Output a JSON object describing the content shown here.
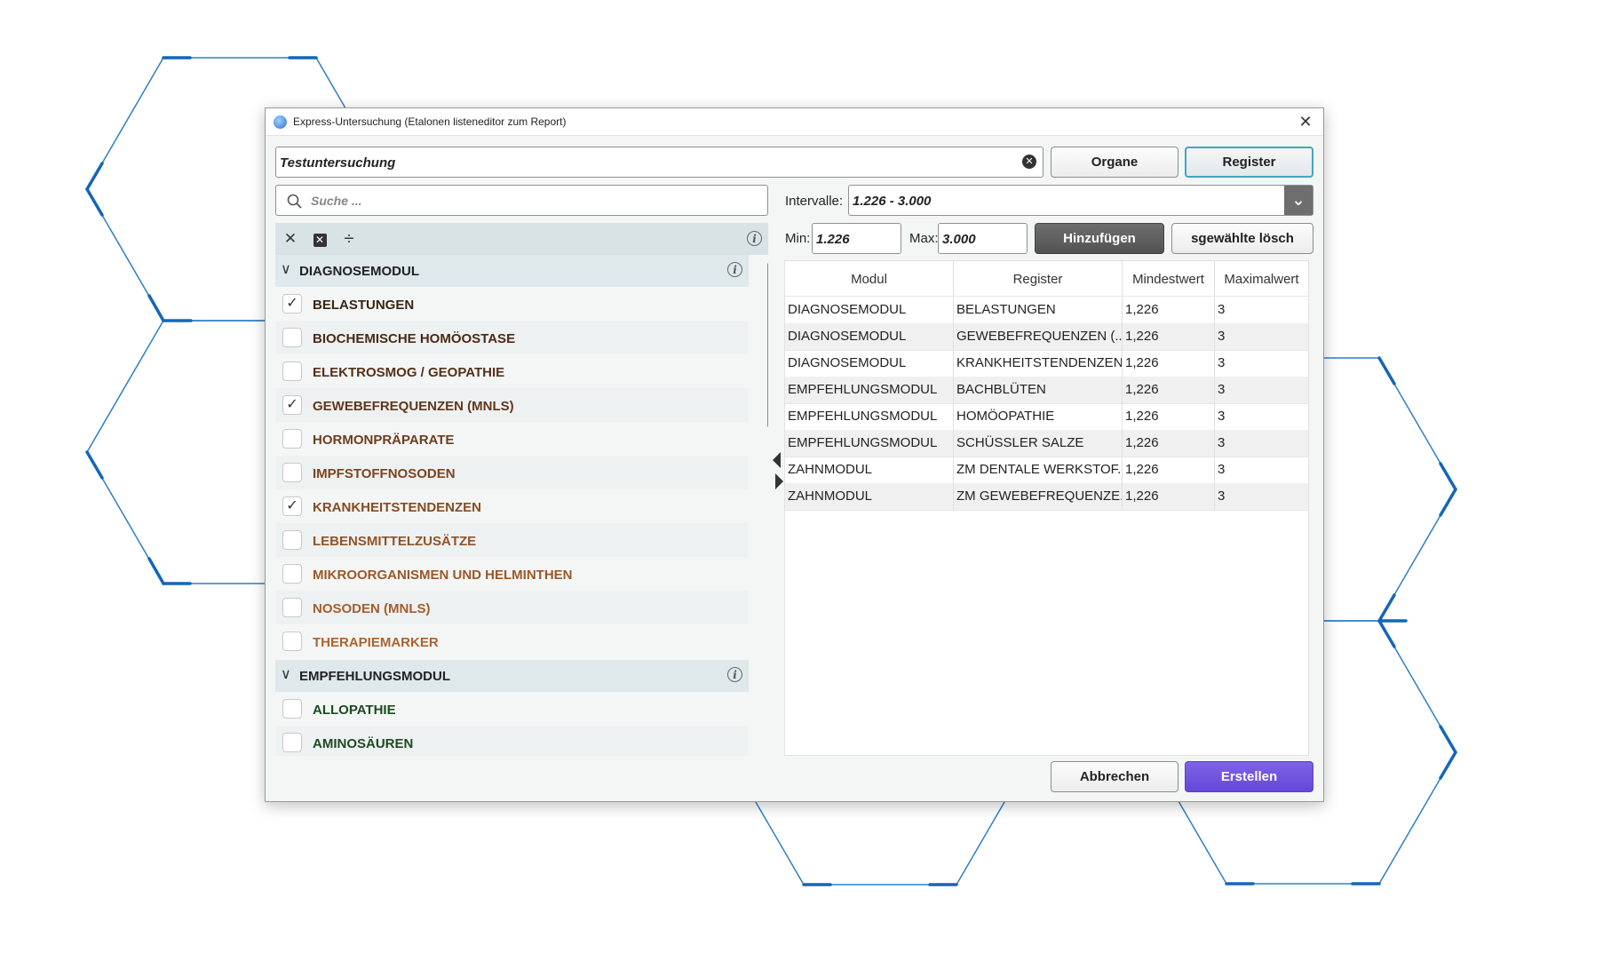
{
  "window": {
    "title": "Express-Untersuchung (Etalonen listeneditor zum Report)"
  },
  "name_field": {
    "value": "Testuntersuchung"
  },
  "mode_buttons": {
    "organe": "Organe",
    "register": "Register"
  },
  "search": {
    "placeholder": "Suche ..."
  },
  "interval": {
    "label": "Intervalle:",
    "value": "1.226 - 3.000"
  },
  "range": {
    "min_label": "Min:",
    "min_value": "1.226",
    "max_label": "Max:",
    "max_value": "3.000",
    "add_label": "Hinzufügen",
    "delete_label": "sgewählte lösch"
  },
  "tree": {
    "groups": [
      {
        "label": "DIAGNOSEMODUL",
        "items": [
          {
            "label": "BELASTUNGEN",
            "checked": true,
            "color": "#3a2414"
          },
          {
            "label": "BIOCHEMISCHE HOMÖOSTASE",
            "checked": false,
            "color": "#4a2a16"
          },
          {
            "label": "ELEKTROSMOG / GEOPATHIE",
            "checked": false,
            "color": "#55301a"
          },
          {
            "label": "GEWEBEFREQUENZEN (MNLS)",
            "checked": true,
            "color": "#60361c"
          },
          {
            "label": "HORMONPRÄPARATE",
            "checked": false,
            "color": "#6c3d1e"
          },
          {
            "label": "IMPFSTOFFNOSODEN",
            "checked": false,
            "color": "#7a4420"
          },
          {
            "label": "KRANKHEITSTENDENZEN",
            "checked": true,
            "color": "#864b22"
          },
          {
            "label": "LEBENSMITTELZUSÄTZE",
            "checked": false,
            "color": "#925226"
          },
          {
            "label": "MIKROORGANISMEN UND HELMINTHEN",
            "checked": false,
            "color": "#9a5828"
          },
          {
            "label": "NOSODEN (MNLS)",
            "checked": false,
            "color": "#a25e2c"
          },
          {
            "label": "THERAPIEMARKER",
            "checked": false,
            "color": "#aa6430"
          }
        ]
      },
      {
        "label": "EMPFEHLUNGSMODUL",
        "items": [
          {
            "label": "ALLOPATHIE",
            "checked": false,
            "color": "#1e4a1e"
          },
          {
            "label": "AMINOSÄUREN",
            "checked": false,
            "color": "#1e4a1e"
          }
        ]
      }
    ]
  },
  "table": {
    "headers": [
      "Modul",
      "Register",
      "Mindestwert",
      "Maximalwert"
    ],
    "rows": [
      [
        "DIAGNOSEMODUL",
        "BELASTUNGEN",
        "1,226",
        "3"
      ],
      [
        "DIAGNOSEMODUL",
        "GEWEBEFREQUENZEN (...",
        "1,226",
        "3"
      ],
      [
        "DIAGNOSEMODUL",
        "KRANKHEITSTENDENZEN",
        "1,226",
        "3"
      ],
      [
        "EMPFEHLUNGSMODUL",
        "BACHBLÜTEN",
        "1,226",
        "3"
      ],
      [
        "EMPFEHLUNGSMODUL",
        "HOMÖOPATHIE",
        "1,226",
        "3"
      ],
      [
        "EMPFEHLUNGSMODUL",
        "SCHÜSSLER SALZE",
        "1,226",
        "3"
      ],
      [
        "ZAHNMODUL",
        "ZM DENTALE WERKSTOF...",
        "1,226",
        "3"
      ],
      [
        "ZAHNMODUL",
        "ZM GEWEBEFREQUENZE...",
        "1,226",
        "3"
      ]
    ]
  },
  "footer": {
    "cancel": "Abbrechen",
    "create": "Erstellen"
  },
  "colors": {
    "accent": "#41a5c6",
    "primary": "#6647d8",
    "hexagon": "#2f7fc0"
  },
  "icons": [
    "app-globe-icon",
    "close-icon",
    "clear-input-icon",
    "search-icon",
    "collapse-all-icon",
    "uncheck-all-icon",
    "expand-collapse-icon",
    "info-icon",
    "chevron-down-icon",
    "check-icon",
    "arrow-left-icon",
    "arrow-right-icon"
  ]
}
